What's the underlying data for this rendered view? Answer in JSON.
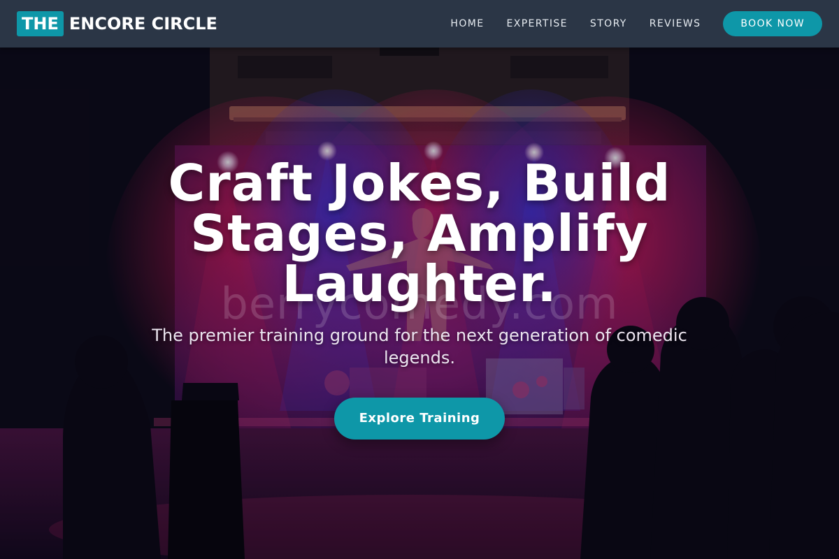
{
  "nav": {
    "brand_badge": "THE",
    "brand_name": "ENCORE CIRCLE",
    "links": [
      {
        "label": "HOME"
      },
      {
        "label": "EXPERTISE"
      },
      {
        "label": "STORY"
      },
      {
        "label": "REVIEWS"
      }
    ],
    "cta_label": "BOOK NOW"
  },
  "hero": {
    "headline": "Craft Jokes, Build Stages, Amplify Laughter.",
    "subheadline": "The premier training ground for the next generation of comedic legends.",
    "cta_label": "Explore Training",
    "background_watermark": "berrycomedy.com"
  },
  "colors": {
    "accent": "#0e97a8",
    "navbar": "#2b3646",
    "stage_red": "#d81a5a",
    "stage_blue": "#3b32c8"
  }
}
